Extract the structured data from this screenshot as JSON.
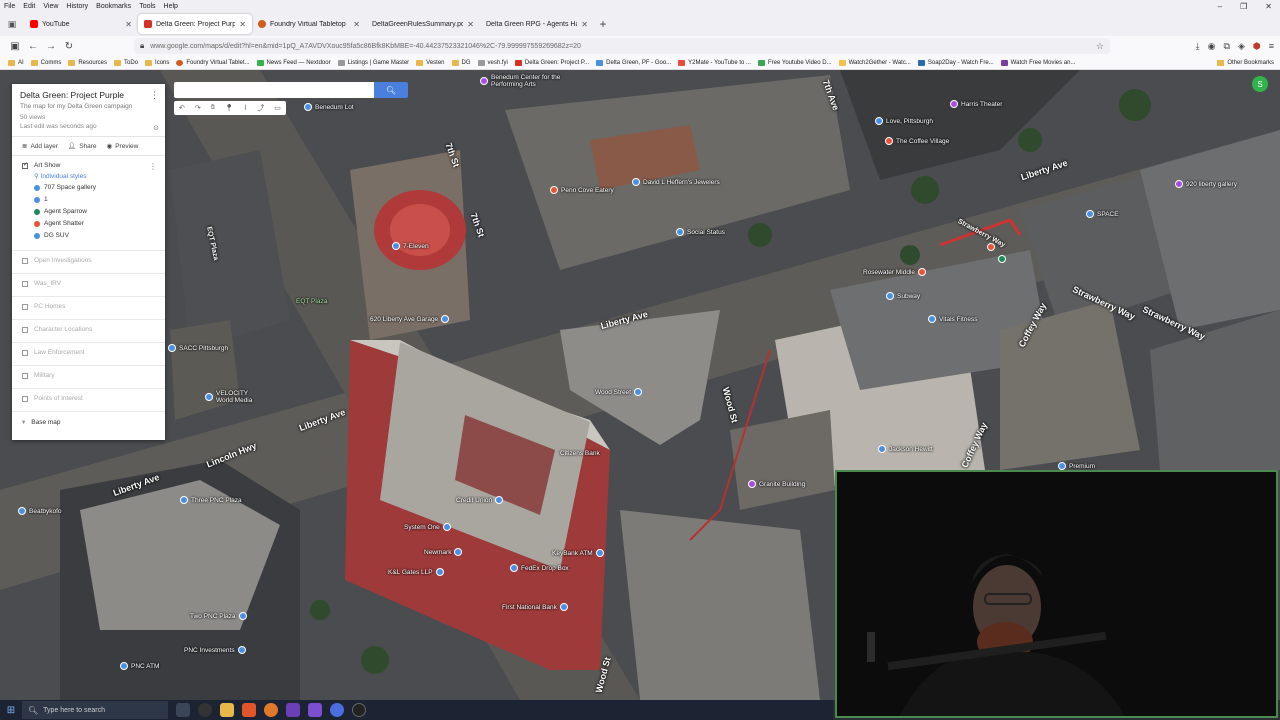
{
  "menubar": {
    "items": [
      "File",
      "Edit",
      "View",
      "History",
      "Bookmarks",
      "Tools",
      "Help"
    ]
  },
  "tabs": [
    {
      "label": "YouTube",
      "color": "#ff0000",
      "active": false
    },
    {
      "label": "Delta Green: Project Purple - Go",
      "color": "#d93025",
      "active": true
    },
    {
      "label": "Foundry Virtual Tabletop",
      "color": "#d35a1c",
      "active": false
    },
    {
      "label": "DeltaGreenRulesSummary.pdf",
      "color": "#888888",
      "active": false
    },
    {
      "label": "Delta Green RPG - Agents Handbo",
      "color": "#6b6b6b",
      "active": false
    }
  ],
  "url": "www.google.com/maps/d/edit?hl=en&mid=1pQ_A7AVDVXouc95fa5c86Bfk8KbMBE=-40.44237523321046%2C-79.999997559269682z=20",
  "bookmarks": [
    "AI",
    "Comms",
    "Resources",
    "ToDo",
    "Icons",
    "Foundry Virtual Tablet...",
    "News Feed — Nextdoor",
    "Listings | Game Master",
    "Vesten",
    "DG",
    "vesh.fyi",
    "Delta Green: Project P...",
    "Delta Green, PF - Goo...",
    "Y2Mate - YouTube to ...",
    "Free Youtube Video D...",
    "Watch2Gether - Watc...",
    "Soap2Day - Watch Fre...",
    "Watch Free Movies an..."
  ],
  "bookmarks_other": "Other Bookmarks",
  "map_search": {
    "placeholder": "",
    "button_icon": "search-icon"
  },
  "panel": {
    "title": "Delta Green: Project Purple",
    "description": "The map for my Delta Green campaign",
    "views": "50 views",
    "last_edit": "Last edit was seconds ago",
    "actions": [
      "Add layer",
      "Share",
      "Preview"
    ],
    "active_layer": {
      "name": "Art Show",
      "style": "Individual styles",
      "features": [
        {
          "name": "707 Space gallery",
          "color": "#4a90e2"
        },
        {
          "name": "1",
          "color": "#4a90e2"
        },
        {
          "name": "Agent Sparrow",
          "color": "#1a8a5a"
        },
        {
          "name": "Agent Shatter",
          "color": "#e8543a"
        },
        {
          "name": "DG SUV",
          "color": "#4a90e2"
        }
      ]
    },
    "layers": [
      "Open Investigations",
      "Was_IRV",
      "PC Homes",
      "Character Locations",
      "Law Enforcement",
      "Military",
      "Points of Interest"
    ],
    "base_map": "Base map"
  },
  "streets": [
    "Liberty Ave",
    "Liberty Ave",
    "Liberty Ave",
    "Liberty Ave",
    "Lincoln Hwy",
    "7th St",
    "7th St",
    "Wood St",
    "Wood St",
    "Strawberry Way",
    "Strawberry Way",
    "Coffey Way",
    "Coffey Way",
    "7th Ave",
    "EQT Plaza",
    "Strawberry Way"
  ],
  "pois": [
    {
      "name": "Benedum Lot",
      "color": "#4a90e2"
    },
    {
      "name": "Benedum Center for the Performing Arts",
      "color": "#a84de0"
    },
    {
      "name": "Harris Theater",
      "color": "#a84de0"
    },
    {
      "name": "Love, Pittsburgh",
      "color": "#4a90e2"
    },
    {
      "name": "The Coffee Village",
      "color": "#e8543a"
    },
    {
      "name": "Penn Cove Eatery",
      "color": "#e8543a"
    },
    {
      "name": "David L Heffern's Jewelers",
      "color": "#4a90e2"
    },
    {
      "name": "Social Status",
      "color": "#4a90e2"
    },
    {
      "name": "7-Eleven",
      "color": "#4a90e2"
    },
    {
      "name": "620 Liberty Ave Garage",
      "color": "#4a90e2"
    },
    {
      "name": "EQT Plaza",
      "color": "#4a90e2"
    },
    {
      "name": "SACC Pittsburgh",
      "color": "#4a90e2"
    },
    {
      "name": "VELOCITY World Media",
      "color": "#4a90e2"
    },
    {
      "name": "Rosewater Middle",
      "color": "#e8543a"
    },
    {
      "name": "Subway",
      "color": "#4a90e2"
    },
    {
      "name": "Vitals Fitness",
      "color": "#4a90e2"
    },
    {
      "name": "SPACE",
      "color": "#4a90e2"
    },
    {
      "name": "920 liberty gallery",
      "color": "#a84de0"
    },
    {
      "name": "Wood Street",
      "color": "#4a90e2"
    },
    {
      "name": "Jackson Hewitt",
      "color": "#4a90e2"
    },
    {
      "name": "Granite Building",
      "color": "#a84de0"
    },
    {
      "name": "Premium",
      "color": "#4a90e2"
    },
    {
      "name": "Citizens Bank",
      "color": "#4a90e2"
    },
    {
      "name": "Credit Union",
      "color": "#4a90e2"
    },
    {
      "name": "System One",
      "color": "#4a90e2"
    },
    {
      "name": "Newmark",
      "color": "#4a90e2"
    },
    {
      "name": "K&L Gates LLP",
      "color": "#4a90e2"
    },
    {
      "name": "FedEx Drop Box",
      "color": "#4a90e2"
    },
    {
      "name": "KeyBank ATM",
      "color": "#4a90e2"
    },
    {
      "name": "First National Bank",
      "color": "#4a90e2"
    },
    {
      "name": "Two PNC Plaza",
      "color": "#4a90e2"
    },
    {
      "name": "PNC Investments",
      "color": "#4a90e2"
    },
    {
      "name": "PNC ATM",
      "color": "#4a90e2"
    },
    {
      "name": "Beatbykofo",
      "color": "#4a90e2"
    },
    {
      "name": "Three PNC Plaza",
      "color": "#4a90e2"
    }
  ],
  "taskbar": {
    "search_placeholder": "Type here to search"
  },
  "colors": {
    "accent": "#4a7fe0",
    "webcam_border": "#4a8a4e"
  }
}
